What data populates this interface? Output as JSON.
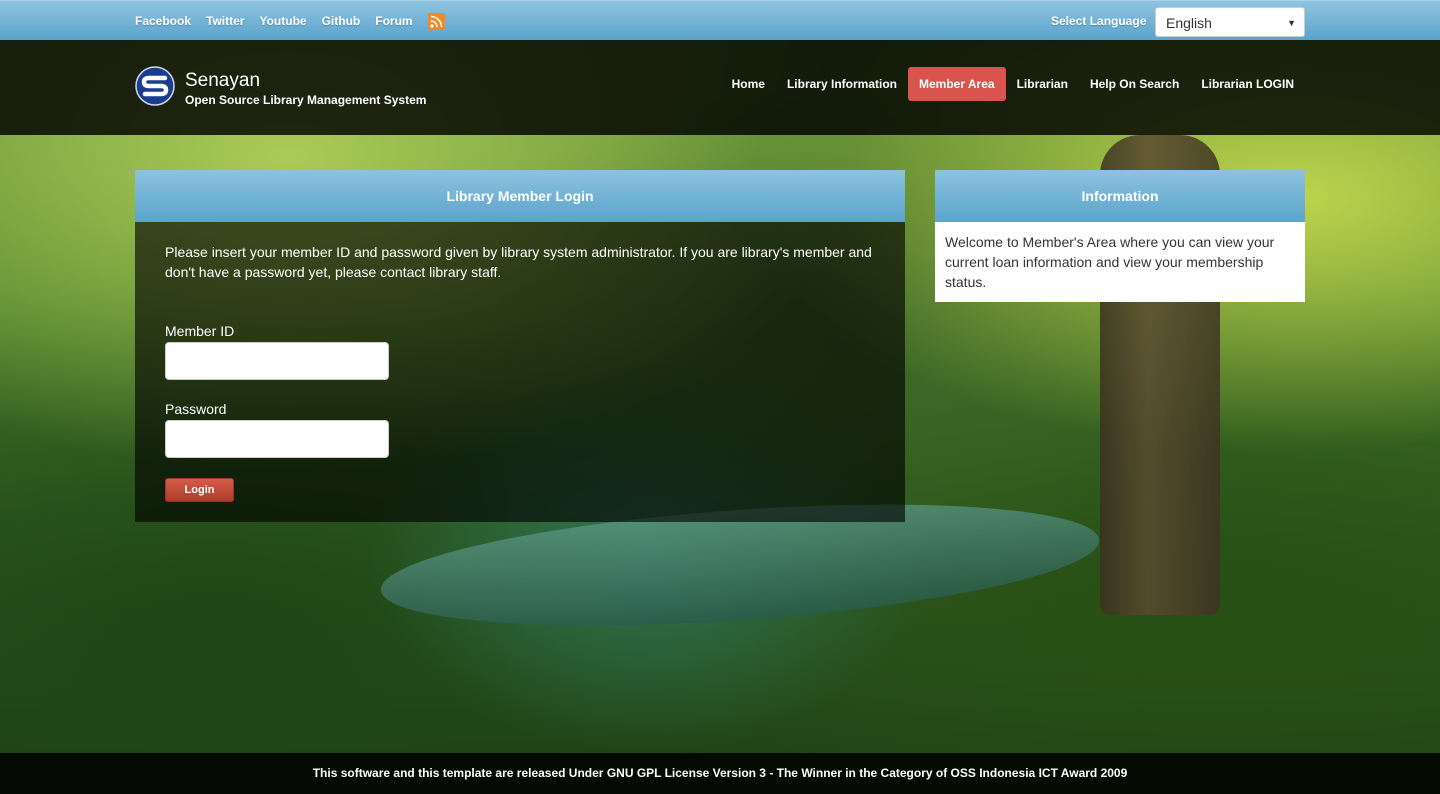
{
  "topbar": {
    "social_links": [
      "Facebook",
      "Twitter",
      "Youtube",
      "Github",
      "Forum"
    ],
    "rss_icon": "rss-icon",
    "language_label": "Select Language",
    "language_selected": "English"
  },
  "header": {
    "brand_title": "Senayan",
    "brand_subtitle": "Open Source Library Management System",
    "nav": [
      "Home",
      "Library Information",
      "Member Area",
      "Librarian",
      "Help On Search",
      "Librarian LOGIN"
    ],
    "active_nav": "Member Area",
    "active_color": "#d9534f"
  },
  "login_panel": {
    "title": "Library Member Login",
    "intro": "Please insert your member ID and password given by library system administrator. If you are library's member and don't have a password yet, please contact library staff.",
    "member_id_label": "Member ID",
    "member_id_value": "",
    "password_label": "Password",
    "password_value": "",
    "login_button": "Login"
  },
  "info_panel": {
    "title": "Information",
    "text": "Welcome to Member's Area where you can view your current loan information and view your membership status."
  },
  "footer": {
    "text": "This software and this template are released Under GNU GPL License Version 3 - The Winner in the Category of OSS Indonesia ICT Award 2009"
  }
}
